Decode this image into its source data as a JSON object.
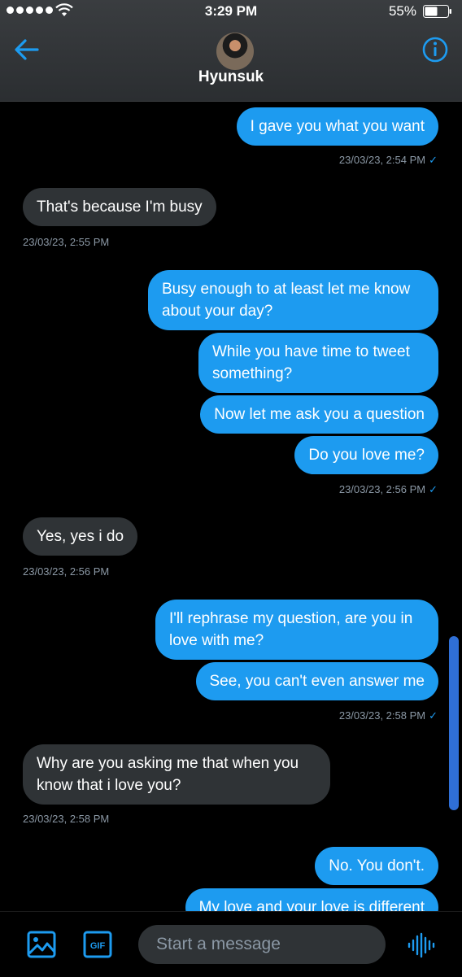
{
  "status_bar": {
    "time": "3:29 PM",
    "battery": "55%"
  },
  "header": {
    "contact_name": "Hyunsuk"
  },
  "messages": [
    {
      "text": "I gave you what you want",
      "dir": "out"
    },
    {
      "meta": "23/03/23, 2:54 PM",
      "dir": "out"
    },
    {
      "text": "That's because I'm busy",
      "dir": "in"
    },
    {
      "meta": "23/03/23, 2:55 PM",
      "dir": "in"
    },
    {
      "text": "Busy enough to at least let me know about your day?",
      "dir": "out"
    },
    {
      "text": "While you have time to tweet something?",
      "dir": "out"
    },
    {
      "text": "Now let me ask you a question",
      "dir": "out"
    },
    {
      "text": "Do you love me?",
      "dir": "out"
    },
    {
      "meta": "23/03/23, 2:56 PM",
      "dir": "out"
    },
    {
      "text": "Yes, yes i do",
      "dir": "in"
    },
    {
      "meta": "23/03/23, 2:56 PM",
      "dir": "in"
    },
    {
      "text": "I'll rephrase my question, are you in love with me?",
      "dir": "out"
    },
    {
      "text": "See, you can't even answer me",
      "dir": "out"
    },
    {
      "meta": "23/03/23, 2:58 PM",
      "dir": "out"
    },
    {
      "text": "Why are you asking me that when you know that i love you?",
      "dir": "in"
    },
    {
      "meta": "23/03/23, 2:58 PM",
      "dir": "in"
    },
    {
      "text": "No. You don't.",
      "dir": "out"
    },
    {
      "text": "My love and your love is different",
      "dir": "out"
    }
  ],
  "composer": {
    "placeholder": "Start a message",
    "gif_label": "GIF"
  },
  "colors": {
    "accent": "#1d9bf0",
    "incoming_bubble": "#2f3336",
    "background": "#000000"
  }
}
